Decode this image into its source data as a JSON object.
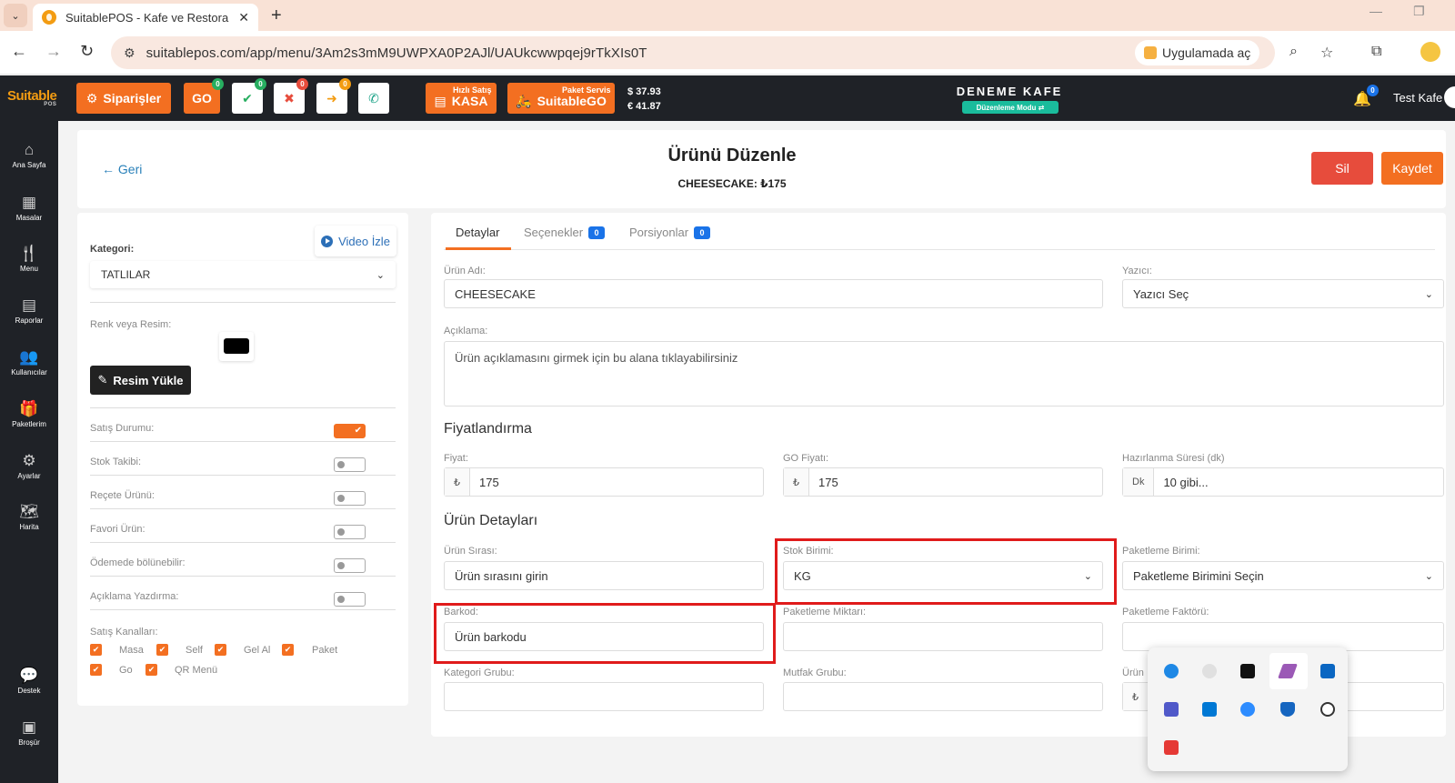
{
  "browser": {
    "tab_title": "SuitablePOS - Kafe ve Restoran Yönetimi",
    "url": "suitablepos.com/app/menu/3Am2s3mM9UWPXA0P2AJl/UAUkcwwpqej9rTkXIs0T",
    "open_in_app": "Uygulamada aç"
  },
  "header": {
    "logo": "Suitable",
    "logo_sub": "POS",
    "orders_label": "Siparişler",
    "go_label": "GO",
    "go_badge": "0",
    "accept_badge": "0",
    "reject_badge": "0",
    "forward_badge": "0",
    "kasa_top": "Hızlı Satış",
    "kasa_label": "KASA",
    "suitablego_top": "Paket Servis",
    "suitablego_label": "SuitableGO",
    "usd": "$  37.93",
    "eur": "€  41.87",
    "cafe_name": "DENEME KAFE",
    "demo_mode": "Düzenleme Modu ⇄",
    "bell_badge": "0",
    "user": "Test Kafe"
  },
  "sidebar": {
    "items": [
      {
        "label": "Ana Sayfa",
        "icon": "home-icon"
      },
      {
        "label": "Masalar",
        "icon": "table-icon"
      },
      {
        "label": "Menu",
        "icon": "utensils-icon"
      },
      {
        "label": "Raporlar",
        "icon": "report-icon"
      },
      {
        "label": "Kullanıcılar",
        "icon": "users-icon"
      },
      {
        "label": "Paketlerim",
        "icon": "gift-icon"
      },
      {
        "label": "Ayarlar",
        "icon": "gears-icon"
      },
      {
        "label": "Harita",
        "icon": "map-icon"
      },
      {
        "label": "Destek",
        "icon": "chat-icon"
      },
      {
        "label": "Broşür",
        "icon": "brochure-icon"
      }
    ]
  },
  "page": {
    "back": "Geri",
    "title": "Ürünü Düzenle",
    "subtitle": "CHEESECAKE: ₺175",
    "delete": "Sil",
    "save": "Kaydet"
  },
  "left": {
    "video": "Video İzle",
    "category_label": "Kategori:",
    "category_value": "TATLILAR",
    "color_label": "Renk veya Resim:",
    "upload": "Resim Yükle",
    "toggles": [
      {
        "label": "Satış Durumu:",
        "on": true
      },
      {
        "label": "Stok Takibi:",
        "on": false
      },
      {
        "label": "Reçete Ürünü:",
        "on": false
      },
      {
        "label": "Favori Ürün:",
        "on": false
      },
      {
        "label": "Ödemede bölünebilir:",
        "on": false
      },
      {
        "label": "Açıklama Yazdırma:",
        "on": false
      }
    ],
    "channels_label": "Satış Kanalları:",
    "channels": [
      "Masa",
      "Self",
      "Gel Al",
      "Paket",
      "Go",
      "QR Menü"
    ]
  },
  "tabs": {
    "details": "Detaylar",
    "options": "Seçenekler",
    "options_count": "0",
    "portions": "Porsiyonlar",
    "portions_count": "0"
  },
  "form": {
    "name_label": "Ürün Adı:",
    "name_value": "CHEESECAKE",
    "printer_label": "Yazıcı:",
    "printer_value": "Yazıcı Seç",
    "desc_label": "Açıklama:",
    "desc_placeholder": "Ürün açıklamasını girmek için bu alana tıklayabilirsiniz",
    "pricing_title": "Fiyatlandırma",
    "price_label": "Fiyat:",
    "price_prefix": "₺",
    "price_value": "175",
    "go_price_label": "GO Fiyatı:",
    "go_price_value": "175",
    "prep_label": "Hazırlanma Süresi (dk)",
    "prep_prefix": "Dk",
    "prep_placeholder": "10 gibi...",
    "details_title": "Ürün Detayları",
    "order_label": "Ürün Sırası:",
    "order_placeholder": "Ürün sırasını girin",
    "stock_unit_label": "Stok Birimi:",
    "stock_unit_value": "KG",
    "pack_unit_label": "Paketleme Birimi:",
    "pack_unit_value": "Paketleme Birimini Seçin",
    "barcode_label": "Barkod:",
    "barcode_placeholder": "Ürün barkodu",
    "pack_qty_label": "Paketleme Miktarı:",
    "pack_factor_label": "Paketleme Faktörü:",
    "cat_group_label": "Kategori Grubu:",
    "kitchen_group_label": "Mutfak Grubu:",
    "cost_label": "Ürün",
    "cost_prefix": "₺"
  }
}
